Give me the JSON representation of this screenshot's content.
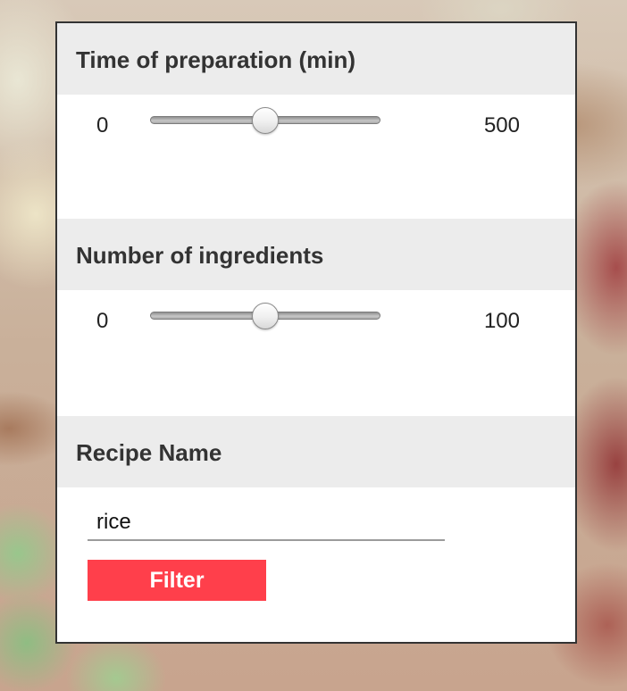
{
  "filters": {
    "prep_time": {
      "title": "Time of preparation (min)",
      "min_label": "0",
      "max_label": "500",
      "value_fraction": 0.5
    },
    "ingredients": {
      "title": "Number of ingredients",
      "min_label": "0",
      "max_label": "100",
      "value_fraction": 0.5
    },
    "recipe_name": {
      "title": "Recipe Name",
      "input_value": "rice",
      "button_label": "Filter"
    }
  },
  "colors": {
    "accent": "#ff3f4b",
    "header_bg": "#ececec",
    "border": "#333333"
  }
}
